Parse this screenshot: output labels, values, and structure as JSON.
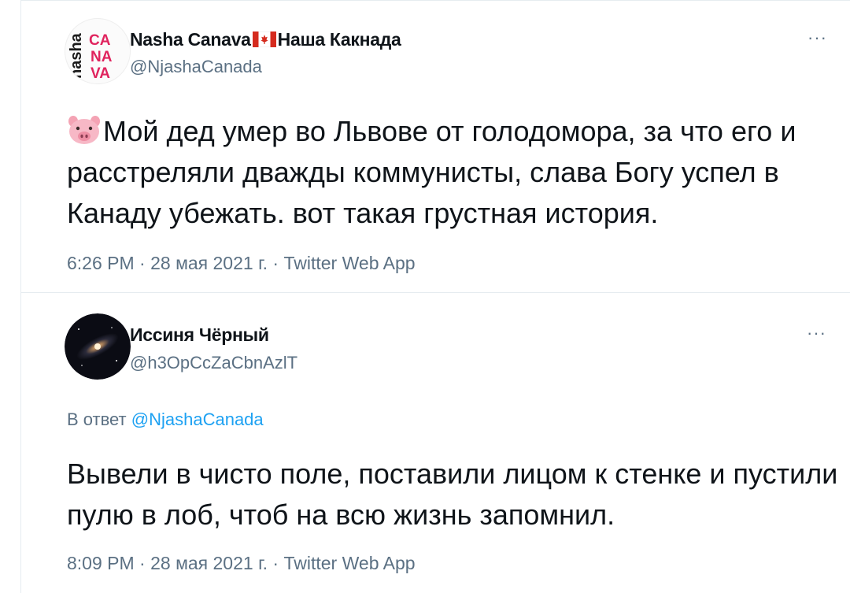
{
  "tweet1": {
    "avatar_label": "nasha CANAVA",
    "display_name_part1": "Nasha Canava",
    "display_name_part2": "Наша Какнада",
    "handle": "@NjashaCanada",
    "text": "Мой дед умер во Львове от голодомора, за что его и расстреляли дважды коммунисты, слава Богу успел в Канаду убежать. вот такая грустная история.",
    "timestamp": "6:26 PM · 28 мая 2021 г. · Twitter Web App",
    "more_label": "···"
  },
  "tweet2": {
    "display_name": "Иссиня Чёрный",
    "handle": "@h3OpCcZaCbnAzlT",
    "reply_prefix": "В ответ",
    "reply_handle": "@NjashaCanada",
    "text": "Вывели в чисто поле, поставили лицом к стенке и пустили пулю в лоб, чтоб на всю жизнь запомнил.",
    "timestamp": "8:09 PM · 28 мая 2021 г. · Twitter Web App",
    "more_label": "···"
  },
  "icons": {
    "tweet1_emoji": "pig-face-icon",
    "flag": "canada-flag-icon",
    "more": "more-icon"
  },
  "colors": {
    "secondary_text": "#5b7083",
    "link": "#1da1f2",
    "brand_red": "#e0245e"
  }
}
